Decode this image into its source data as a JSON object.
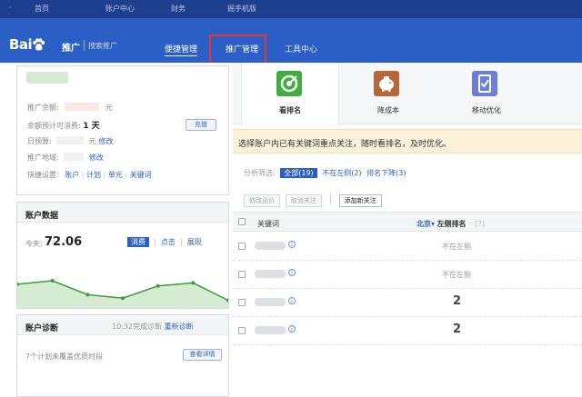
{
  "topnav": [
    "首页",
    "账户中心",
    "财务",
    "掘手机版"
  ],
  "logo": {
    "brand": "Bai",
    "brand2": "du",
    "tui": "推广",
    "sub": "搜索推广"
  },
  "nav": {
    "bianjie": "便捷管理",
    "tuiguang": "推广管理",
    "gongju": "工具中心"
  },
  "account": {
    "balance_label": "推广余额:",
    "balance_unit": "元",
    "days_label": "余额预计可消费:",
    "days_value": "1 天",
    "recharge": "充值",
    "budget_label": "日预算:",
    "budget_unit": "元",
    "budget_edit": "修改",
    "region_label": "推广地域:",
    "region_edit": "修改",
    "quick_label": "快捷设置:",
    "quick_links": [
      "账户",
      "计划",
      "单元",
      "关键词"
    ]
  },
  "data_panel": {
    "title": "账户数据",
    "today_label": "今天:",
    "today_value": "72.06",
    "tabs": [
      "消费",
      "点击",
      "展现"
    ],
    "trend": [
      0.58,
      0.5,
      0.82,
      0.9,
      0.62,
      0.55,
      0.95
    ]
  },
  "diag": {
    "title": "账户诊断",
    "time": "10:32完成诊断",
    "rediag": "重新诊断",
    "text": "7个计划未覆盖优质时段",
    "detail": "查看详情"
  },
  "tools": [
    {
      "label": "看排名",
      "icon": "target-icon",
      "color": "#3fae3c"
    },
    {
      "label": "降成本",
      "icon": "piggy-bank-icon",
      "color": "#b5673a"
    },
    {
      "label": "移动优化",
      "icon": "mobile-check-icon",
      "color": "#6c7ed8"
    }
  ],
  "notice": "选择账户内已有关键词重点关注，随时看排名，及时优化。",
  "filter": {
    "label": "分析筛选:",
    "all": "全部(19)",
    "not_left": "不在左侧(2)",
    "drop": "排名下降(3)"
  },
  "actions": {
    "edit_bid": "修改出价",
    "cancel": "取消关注",
    "add": "添加新关注"
  },
  "table": {
    "col_keyword": "关键词",
    "col_region": "北京",
    "col_rank": "左侧排名",
    "col_help": "?",
    "rows": [
      {
        "rank": "不在左侧",
        "numeric": false
      },
      {
        "rank": "不在左侧",
        "numeric": false
      },
      {
        "rank": "2",
        "numeric": true
      },
      {
        "rank": "2",
        "numeric": true
      }
    ]
  }
}
